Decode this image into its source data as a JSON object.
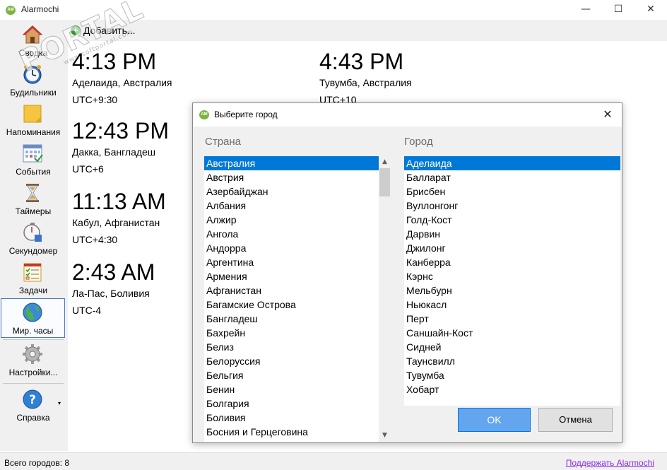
{
  "window": {
    "app_icon_text": "AM",
    "title": "Alarmochi",
    "minimize_glyph": "—",
    "maximize_glyph": "☐",
    "close_glyph": "✕"
  },
  "sidebar": {
    "items": [
      {
        "label": "Сводка",
        "icon": "home-icon"
      },
      {
        "label": "Будильники",
        "icon": "alarm-clock-icon"
      },
      {
        "label": "Напоминания",
        "icon": "sticky-note-icon"
      },
      {
        "label": "События",
        "icon": "calendar-icon"
      },
      {
        "label": "Таймеры",
        "icon": "hourglass-icon"
      },
      {
        "label": "Секундомер",
        "icon": "stopwatch-icon"
      },
      {
        "label": "Задачи",
        "icon": "checklist-icon"
      },
      {
        "label": "Мир. часы",
        "icon": "globe-icon",
        "active": true
      },
      {
        "label": "Настройки...",
        "icon": "gear-icon"
      },
      {
        "label": "Справка",
        "icon": "help-icon"
      }
    ]
  },
  "toolbar": {
    "add_label": "Добавить...",
    "add_icon": "plus-icon"
  },
  "watermark": {
    "text": "PORTAL",
    "sub": "www.softportal.com",
    "tm": "TM"
  },
  "clocks": [
    {
      "time": "4:13 PM",
      "city": "Аделаида, Австралия",
      "utc": "UTC+9:30"
    },
    {
      "time": "4:43 PM",
      "city": "Тувумба, Австралия",
      "utc": "UTC+10"
    },
    {
      "time": "12:43 PM",
      "city": "Дакка, Бангладеш",
      "utc": "UTC+6"
    },
    {
      "time": "11:13 AM",
      "city": "Кабул, Афганистан",
      "utc": "UTC+4:30"
    },
    {
      "time": "2:43 AM",
      "city": "Ла-Пас, Боливия",
      "utc": "UTC-4"
    }
  ],
  "dialog": {
    "icon_text": "AM",
    "title": "Выберите город",
    "close_glyph": "✕",
    "country_header": "Страна",
    "city_header": "Город",
    "countries": [
      "Австралия",
      "Австрия",
      "Азербайджан",
      "Албания",
      "Алжир",
      "Ангола",
      "Андорра",
      "Аргентина",
      "Армения",
      "Афганистан",
      "Багамские Острова",
      "Бангладеш",
      "Бахрейн",
      "Белиз",
      "Белоруссия",
      "Бельгия",
      "Бенин",
      "Болгария",
      "Боливия",
      "Босния и Герцеговина"
    ],
    "selected_country": "Австралия",
    "cities": [
      "Аделаида",
      "Балларат",
      "Брисбен",
      "Вуллонгонг",
      "Голд-Кост",
      "Дарвин",
      "Джилонг",
      "Канберра",
      "Кэрнс",
      "Мельбурн",
      "Ньюкасл",
      "Перт",
      "Саншайн-Кост",
      "Сидней",
      "Таунсвилл",
      "Тувумба",
      "Хобарт"
    ],
    "selected_city": "Аделаида",
    "ok_label": "OK",
    "cancel_label": "Отмена",
    "scroll_up_glyph": "▲",
    "scroll_down_glyph": "▼"
  },
  "status": {
    "count_text": "Всего городов: 8",
    "support_link": "Поддержать Alarmochi"
  },
  "colors": {
    "selection": "#0078d7",
    "ok_button": "#64a5f0",
    "link": "#8a2be2"
  }
}
